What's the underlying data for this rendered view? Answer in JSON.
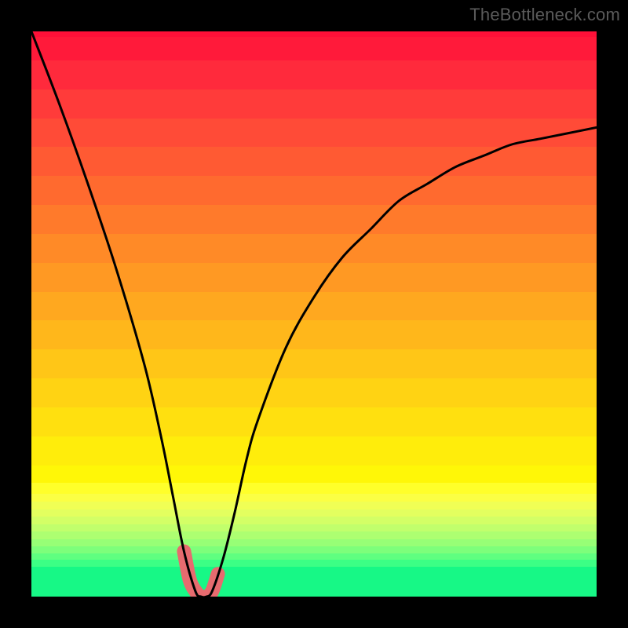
{
  "watermark": "TheBottleneck.com",
  "chart_data": {
    "type": "line",
    "title": "",
    "xlabel": "",
    "ylabel": "",
    "xlim": [
      0,
      100
    ],
    "ylim": [
      0,
      100
    ],
    "legend": "none",
    "grid": false,
    "annotations": [],
    "series": [
      {
        "name": "bottleneck-curve",
        "x": [
          0,
          5,
          10,
          15,
          20,
          23,
          25,
          27,
          29,
          30,
          31,
          32,
          34,
          36,
          38,
          40,
          45,
          50,
          55,
          60,
          65,
          70,
          75,
          80,
          85,
          90,
          95,
          100
        ],
        "values": [
          100,
          87,
          73,
          58,
          41,
          28,
          18,
          8,
          1,
          0,
          0,
          1,
          7,
          15,
          24,
          31,
          44,
          53,
          60,
          65,
          70,
          73,
          76,
          78,
          80,
          81,
          82,
          83
        ]
      }
    ],
    "highlight_segment": {
      "name": "optimal-range",
      "x": [
        27,
        28,
        29,
        30,
        31,
        32,
        33
      ],
      "values": [
        8,
        3,
        1,
        0,
        0,
        1,
        4
      ]
    },
    "background_gradient_bands": [
      {
        "color": "#ff1038",
        "height_pct": 1.0
      },
      {
        "color": "#ff1a3a",
        "height_pct": 4.0
      },
      {
        "color": "#ff2a3c",
        "height_pct": 5.0
      },
      {
        "color": "#ff3b3a",
        "height_pct": 5.0
      },
      {
        "color": "#ff4b37",
        "height_pct": 5.0
      },
      {
        "color": "#ff5a33",
        "height_pct": 5.0
      },
      {
        "color": "#ff6a2f",
        "height_pct": 5.0
      },
      {
        "color": "#ff7a2b",
        "height_pct": 5.0
      },
      {
        "color": "#ff8a27",
        "height_pct": 5.0
      },
      {
        "color": "#ff9923",
        "height_pct": 5.0
      },
      {
        "color": "#ffa81f",
        "height_pct": 5.0
      },
      {
        "color": "#ffb71b",
        "height_pct": 5.0
      },
      {
        "color": "#ffc617",
        "height_pct": 5.0
      },
      {
        "color": "#ffd313",
        "height_pct": 5.0
      },
      {
        "color": "#ffe00f",
        "height_pct": 5.0
      },
      {
        "color": "#ffed0b",
        "height_pct": 5.0
      },
      {
        "color": "#fff707",
        "height_pct": 3.0
      },
      {
        "color": "#ffff2a",
        "height_pct": 2.0
      },
      {
        "color": "#fbff44",
        "height_pct": 1.3
      },
      {
        "color": "#f0ff55",
        "height_pct": 1.3
      },
      {
        "color": "#e3ff5f",
        "height_pct": 1.3
      },
      {
        "color": "#d3ff66",
        "height_pct": 1.3
      },
      {
        "color": "#c1ff6c",
        "height_pct": 1.3
      },
      {
        "color": "#adff71",
        "height_pct": 1.3
      },
      {
        "color": "#97ff76",
        "height_pct": 1.2
      },
      {
        "color": "#7dff7b",
        "height_pct": 1.2
      },
      {
        "color": "#5fff80",
        "height_pct": 1.2
      },
      {
        "color": "#3cff85",
        "height_pct": 1.2
      },
      {
        "color": "#17f886",
        "height_pct": 1.1
      },
      {
        "color": "#17f886",
        "height_pct": 1.0
      },
      {
        "color": "#17f886",
        "height_pct": 1.0
      },
      {
        "color": "#17f886",
        "height_pct": 1.0
      },
      {
        "color": "#17f886",
        "height_pct": 1.0
      }
    ],
    "highlight_color": "#e76b6f",
    "curve_color": "#000000"
  }
}
